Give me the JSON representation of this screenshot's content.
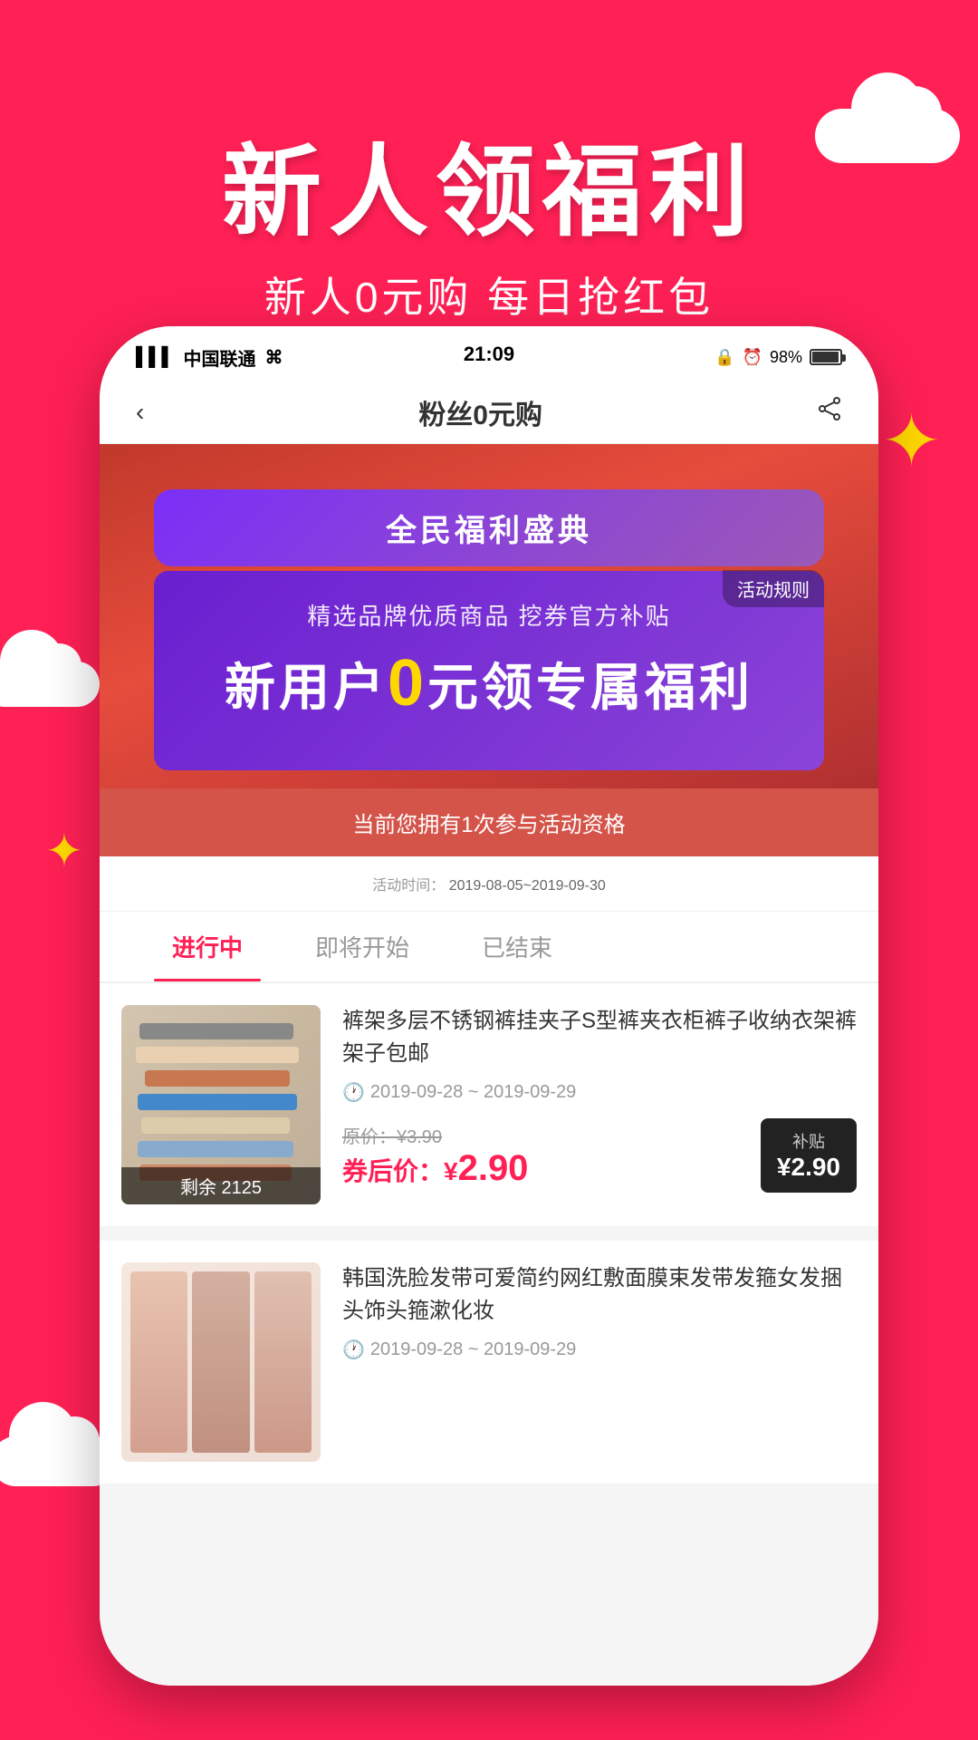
{
  "hero": {
    "title": "新人领福利",
    "subtitle": "新人0元购 每日抢红包"
  },
  "status_bar": {
    "carrier": "中国联通",
    "time": "21:09",
    "battery": "98%"
  },
  "nav": {
    "title": "粉丝0元购",
    "back_label": "‹",
    "share_label": "⊘"
  },
  "banner": {
    "event_title": "全民福利盛典",
    "rules_label": "活动规则",
    "subtitle": "精选品牌优质商品 挖券官方补贴",
    "main_text_prefix": "新用户",
    "main_text_zero": "0",
    "main_text_suffix": "元领专属福利"
  },
  "activity": {
    "qualify_text": "当前您拥有1次参与活动资格",
    "date_label": "活动时间：",
    "date_value": "2019-08-05~2019-09-30"
  },
  "tabs": [
    {
      "label": "进行中",
      "active": true
    },
    {
      "label": "即将开始",
      "active": false
    },
    {
      "label": "已结束",
      "active": false
    }
  ],
  "products": [
    {
      "title": "裤架多层不锈钢裤挂夹子S型裤夹衣柜裤子收纳衣架裤架子包邮",
      "date_range": "2019-09-28 ~ 2019-09-29",
      "original_price": "¥3.90",
      "discount_price_label": "券后价：¥",
      "discount_price": "2.90",
      "subsidy_label": "补贴",
      "subsidy_price": "¥2.90",
      "remaining": "剩余 2125",
      "image_type": "hangers"
    },
    {
      "title": "韩国洗脸发带可爱简约网红敷面膜束发带发箍女发捆头饰头箍漱化妆",
      "date_range": "2019-09-28 ~ 2019-09-29",
      "original_price": "",
      "discount_price_label": "",
      "discount_price": "",
      "subsidy_label": "",
      "subsidy_price": "",
      "remaining": "",
      "image_type": "girls"
    }
  ],
  "colors": {
    "primary": "#ff2055",
    "purple": "#7b2ff7",
    "dark_purple": "#6a1fd0",
    "gold": "#ffd700",
    "dark_red": "#d4544a"
  }
}
